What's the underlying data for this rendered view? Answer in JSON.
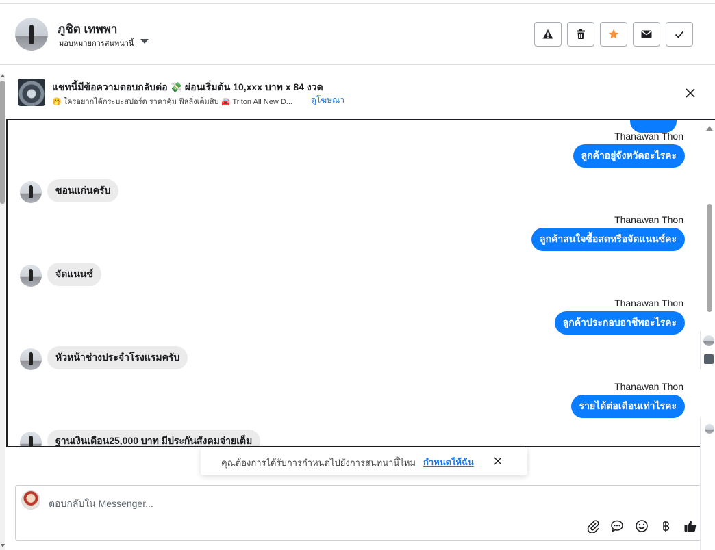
{
  "header": {
    "name": "ภูชิต เทพพา",
    "subtitle": "มอบหมายการสนทนานี้",
    "actions": [
      {
        "name": "report-button",
        "icon": "warning-icon"
      },
      {
        "name": "delete-button",
        "icon": "trash-icon"
      },
      {
        "name": "star-button",
        "icon": "star-icon"
      },
      {
        "name": "mark-unread-button",
        "icon": "envelope-icon"
      },
      {
        "name": "mark-done-button",
        "icon": "check-icon"
      }
    ],
    "star_color": "#f7923a"
  },
  "ad": {
    "title": "แชทนี้มีข้อความตอบกลับต่อ 💸 ผ่อนเริ่มต้น 10,xxx บาท x 84 งวด",
    "description": "🤭 ใครอยากได้กระบะสปอร์ต ราคาคุ้ม ฟีลลิ่งเต็มสิบ 🚘 Triton All New D...",
    "link": "ดูโฆษณา"
  },
  "chat": {
    "messages": [
      {
        "direction": "out",
        "sender": "Thanawan Thon",
        "text": "ลูกค้าอยู่จังหวัดอะไรคะ"
      },
      {
        "direction": "in",
        "text": "ขอนแก่นครับ"
      },
      {
        "direction": "out",
        "sender": "Thanawan Thon",
        "text": "ลูกค้าสนใจซื้อสดหรือจัดแนนซ์คะ"
      },
      {
        "direction": "in",
        "text": "จัดแนนซ์"
      },
      {
        "direction": "out",
        "sender": "Thanawan Thon",
        "text": "ลูกค้าประกอบอาชีพอะไรคะ"
      },
      {
        "direction": "in",
        "text": "หัวหน้าช่างประจำโรงแรมครับ"
      },
      {
        "direction": "out",
        "sender": "Thanawan Thon",
        "text": "รายได้ต่อเดือนเท่าไรคะ"
      },
      {
        "direction": "in",
        "text": "ฐานเงินเดือน25,000 บาท มีประกันสังคมจ่ายเต็ม"
      }
    ],
    "out_color": "#0a7cff",
    "in_color": "#ebebeb"
  },
  "toast": {
    "text": "คุณต้องการได้รับการกำหนดไปยังการสนทนานี้ไหม",
    "link": "กำหนดให้ฉัน"
  },
  "composer": {
    "placeholder": "ตอบกลับใน Messenger...",
    "tools": [
      "paperclip-icon",
      "chat-bubble-icon",
      "smiley-icon",
      "baht-icon",
      "thumbs-up-icon"
    ]
  }
}
